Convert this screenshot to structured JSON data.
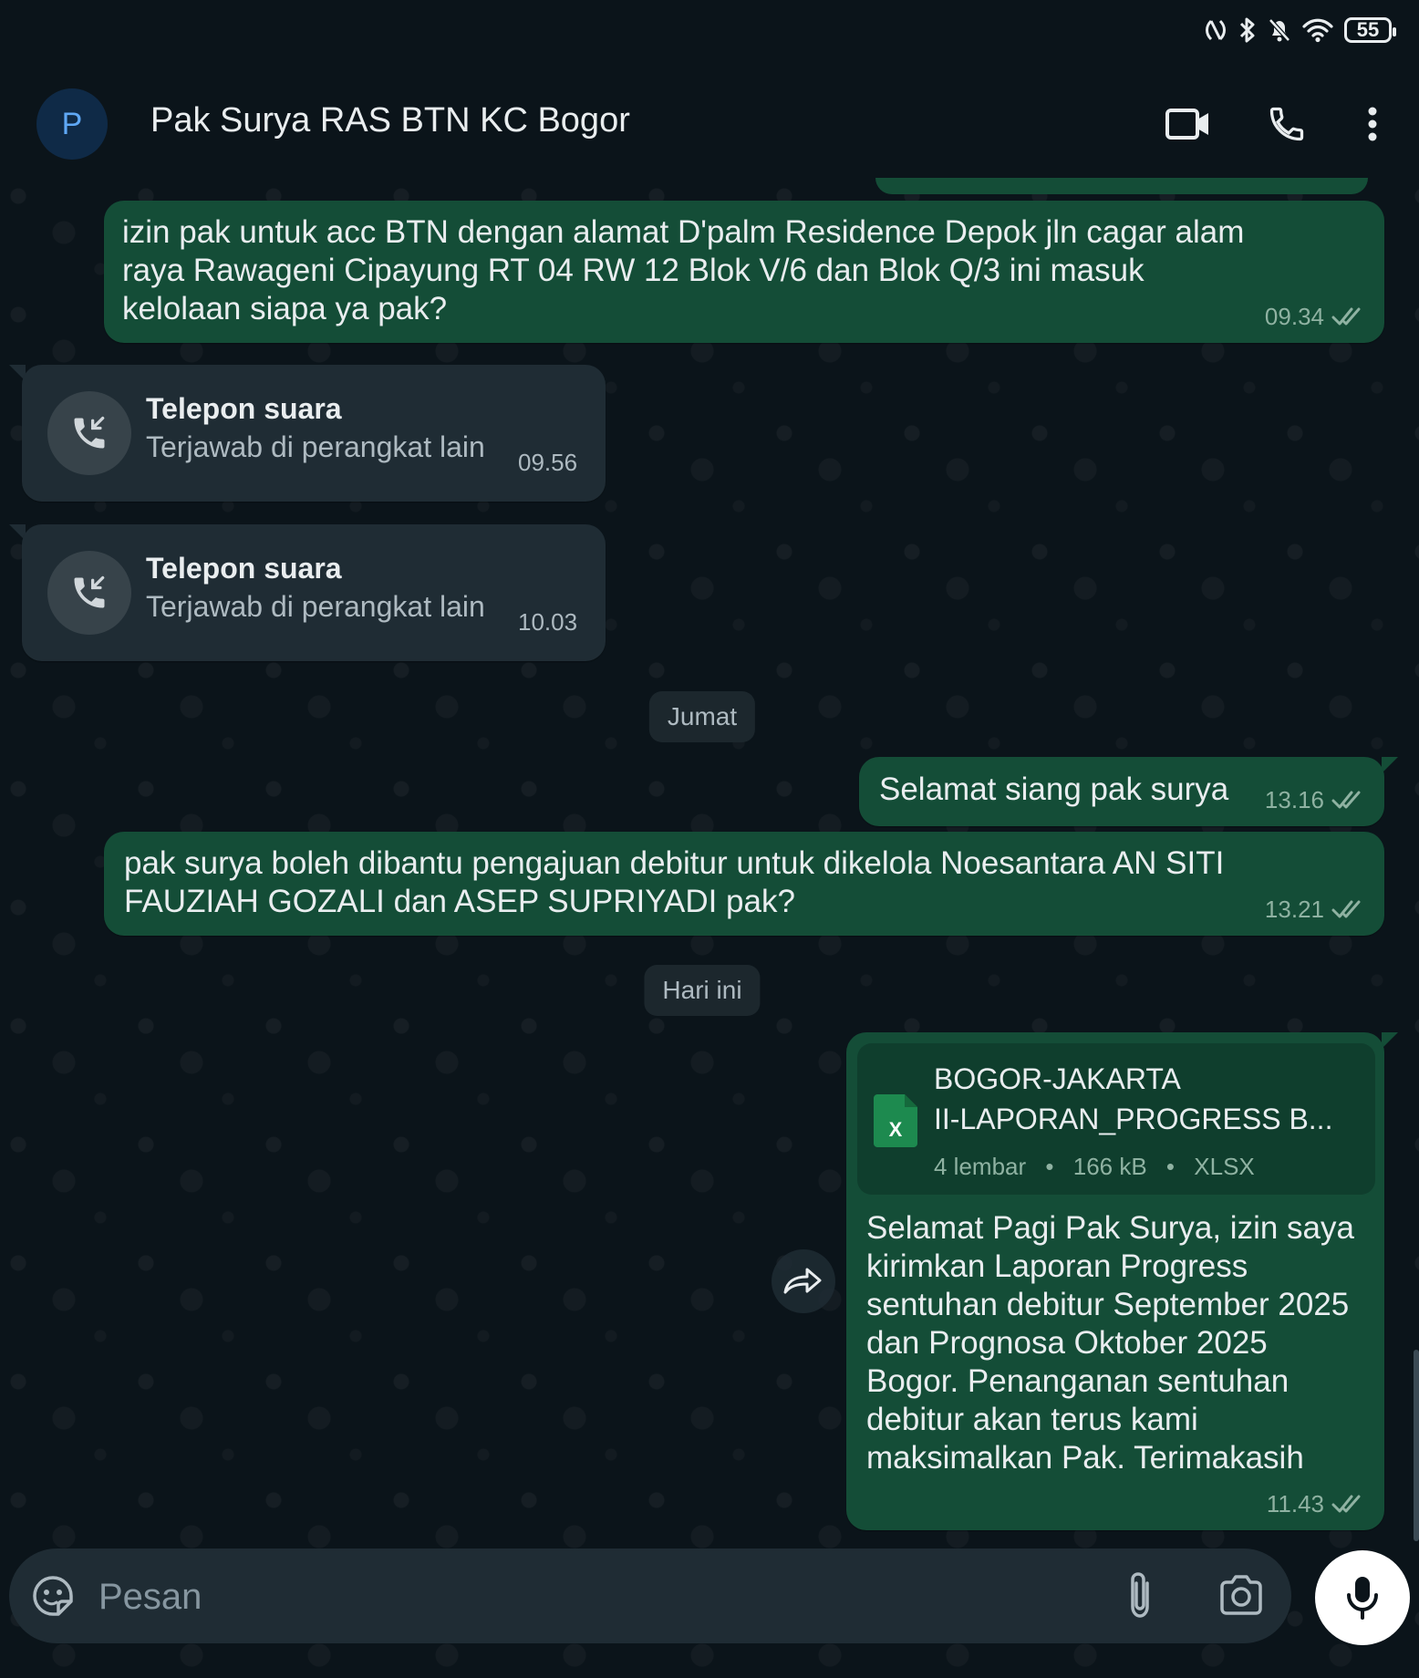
{
  "status_bar": {
    "battery": "55",
    "icons": [
      "nfc-icon",
      "bluetooth-icon",
      "mute-icon",
      "wifi-icon",
      "battery-icon"
    ]
  },
  "header": {
    "avatar_letter": "P",
    "contact_name": "Pak Surya RAS BTN KC Bogor",
    "icons": [
      "video-call-icon",
      "voice-call-icon",
      "more-options-icon"
    ]
  },
  "messages": [
    {
      "type": "outgoing",
      "text": "izin pak untuk acc BTN dengan alamat D'palm Residence Depok jln cagar alam raya Rawageni Cipayung RT 04 RW 12 Blok V/6 dan Blok Q/3 ini masuk kelolaan siapa ya pak?",
      "time": "09.34",
      "status": "read"
    },
    {
      "type": "call",
      "title": "Telepon suara",
      "subtitle": "Terjawab di perangkat lain",
      "time": "09.56"
    },
    {
      "type": "call",
      "title": "Telepon suara",
      "subtitle": "Terjawab di perangkat lain",
      "time": "10.03"
    },
    {
      "type": "date",
      "label": "Jumat"
    },
    {
      "type": "outgoing",
      "text": "Selamat siang pak surya",
      "time": "13.16",
      "status": "read"
    },
    {
      "type": "outgoing",
      "text": "pak surya boleh dibantu pengajuan debitur untuk dikelola Noesantara AN SITI FAUZIAH GOZALI dan ASEP SUPRIYADI pak?",
      "time": "13.21",
      "status": "read"
    },
    {
      "type": "date",
      "label": "Hari ini"
    },
    {
      "type": "outgoing_file",
      "file": {
        "name_line1": "BOGOR-JAKARTA",
        "name_line2": "II-LAPORAN_PROGRESS B...",
        "pages": "4 lembar",
        "size": "166 kB",
        "ext": "XLSX",
        "icon": "xlsx-file-icon",
        "icon_letter": "X"
      },
      "text": "Selamat Pagi Pak Surya, izin saya kirimkan Laporan Progress sentuhan debitur September 2025 dan Prognosa Oktober 2025 Bogor. Penanganan sentuhan debitur akan terus kami maksimalkan Pak. Terimakasih",
      "time": "11.43",
      "status": "read"
    }
  ],
  "composer": {
    "placeholder": "Pesan",
    "icons": [
      "emoji-icon",
      "attach-icon",
      "camera-icon",
      "mic-icon"
    ]
  },
  "colors": {
    "background": "#0b141a",
    "outgoing_bubble": "#144d37",
    "incoming_bubble": "#1f2c34",
    "file_card": "#0f3e2d",
    "xlsx_green": "#1d8a4f",
    "avatar_bg": "#0f2a47"
  }
}
